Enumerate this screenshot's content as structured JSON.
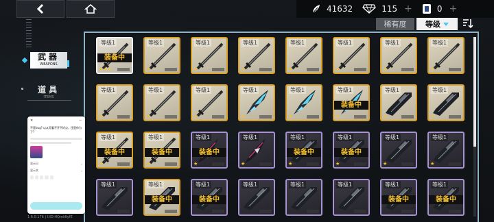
{
  "top": {
    "back_icon": "arrow-left-icon",
    "home_icon": "home-icon",
    "resources": [
      {
        "name": "feather",
        "icon": "feather-icon",
        "value": "41632",
        "plus": ""
      },
      {
        "name": "diamond",
        "icon": "diamond-icon",
        "value": "115",
        "plus": "+"
      },
      {
        "name": "ticket",
        "icon": "ticket-icon",
        "value": "0",
        "plus": "+"
      }
    ]
  },
  "menu": {
    "weapons": {
      "cn": "武器",
      "en": "WEAPONS"
    },
    "items": {
      "cn": "道具",
      "en": "ITEMS"
    }
  },
  "sort": {
    "rarity": "稀有度",
    "level": "等级"
  },
  "equip_label": "装备中",
  "level_label": "等级1",
  "colors": {
    "gold": "#d9a022",
    "purple": "#a793cf",
    "white": "#f2f2f2",
    "accent": "#4bc6ee"
  },
  "rows": [
    [
      {
        "frame": "white",
        "weapon": "katana",
        "equipped": true,
        "stars": "★★★"
      },
      {
        "frame": "gold",
        "weapon": "katana",
        "equipped": false,
        "stars": "★"
      },
      {
        "frame": "gold",
        "weapon": "katana",
        "equipped": false,
        "stars": "★"
      },
      {
        "frame": "gold",
        "weapon": "katana",
        "equipped": false,
        "stars": "★"
      },
      {
        "frame": "gold",
        "weapon": "katana",
        "equipped": false,
        "stars": "★"
      },
      {
        "frame": "gold",
        "weapon": "katana",
        "equipped": false,
        "stars": "★"
      },
      {
        "frame": "gold",
        "weapon": "katana",
        "equipped": false,
        "stars": "★"
      },
      {
        "frame": "gold",
        "weapon": "katana",
        "equipped": false,
        "stars": "★"
      }
    ],
    [
      {
        "frame": "gold",
        "weapon": "katana",
        "equipped": false,
        "stars": "★"
      },
      {
        "frame": "gold",
        "weapon": "katana",
        "equipped": false,
        "stars": "★"
      },
      {
        "frame": "gold",
        "weapon": "katana",
        "equipped": false,
        "stars": "★"
      },
      {
        "frame": "gold",
        "weapon": "crystal",
        "equipped": false,
        "stars": "★"
      },
      {
        "frame": "gold",
        "weapon": "crystal",
        "equipped": false,
        "stars": "★"
      },
      {
        "frame": "gold",
        "weapon": "crystal",
        "equipped": true,
        "stars": "★"
      },
      {
        "frame": "gold",
        "weapon": "rifle",
        "equipped": false,
        "stars": "★"
      },
      {
        "frame": "gold",
        "weapon": "rifle",
        "equipped": false,
        "stars": "★"
      }
    ],
    [
      {
        "frame": "gold",
        "weapon": "katana",
        "equipped": true,
        "stars": "★"
      },
      {
        "frame": "gold",
        "weapon": "katana",
        "equipped": true,
        "stars": "★"
      },
      {
        "frame": "purple",
        "weapon": "blade",
        "equipped": true,
        "stars": "★"
      },
      {
        "frame": "purple",
        "weapon": "blade",
        "equipped": false,
        "stars": "★"
      },
      {
        "frame": "purple",
        "weapon": "rifle",
        "equipped": true,
        "stars": "★"
      },
      {
        "frame": "purple",
        "weapon": "rifle",
        "equipped": true,
        "stars": "★"
      },
      {
        "frame": "purple",
        "weapon": "rifle",
        "equipped": false,
        "stars": "★"
      },
      {
        "frame": "purple",
        "weapon": "rifle",
        "equipped": false,
        "stars": "★"
      }
    ],
    [
      {
        "frame": "purple",
        "weapon": "rifle",
        "equipped": false,
        "stars": ""
      },
      {
        "frame": "gold",
        "weapon": "rifle",
        "equipped": true,
        "stars": ""
      },
      {
        "frame": "purple",
        "weapon": "rifle",
        "equipped": true,
        "stars": ""
      },
      {
        "frame": "purple",
        "weapon": "rifle",
        "equipped": false,
        "stars": ""
      },
      {
        "frame": "purple",
        "weapon": "rifle",
        "equipped": false,
        "stars": ""
      },
      {
        "frame": "purple",
        "weapon": "rifle",
        "equipped": false,
        "stars": ""
      },
      {
        "frame": "purple",
        "weapon": "rifle",
        "equipped": true,
        "stars": ""
      },
      {
        "frame": "purple",
        "weapon": "rifle",
        "equipped": true,
        "stars": ""
      }
    ]
  ],
  "popup": {
    "title": "不是bug? 以从而看不开不好点，还是你为了?",
    "options_label": "显示已",
    "footer_label": "显示文"
  },
  "version": "1.6.0.176 | UID:HQmkKyfE"
}
